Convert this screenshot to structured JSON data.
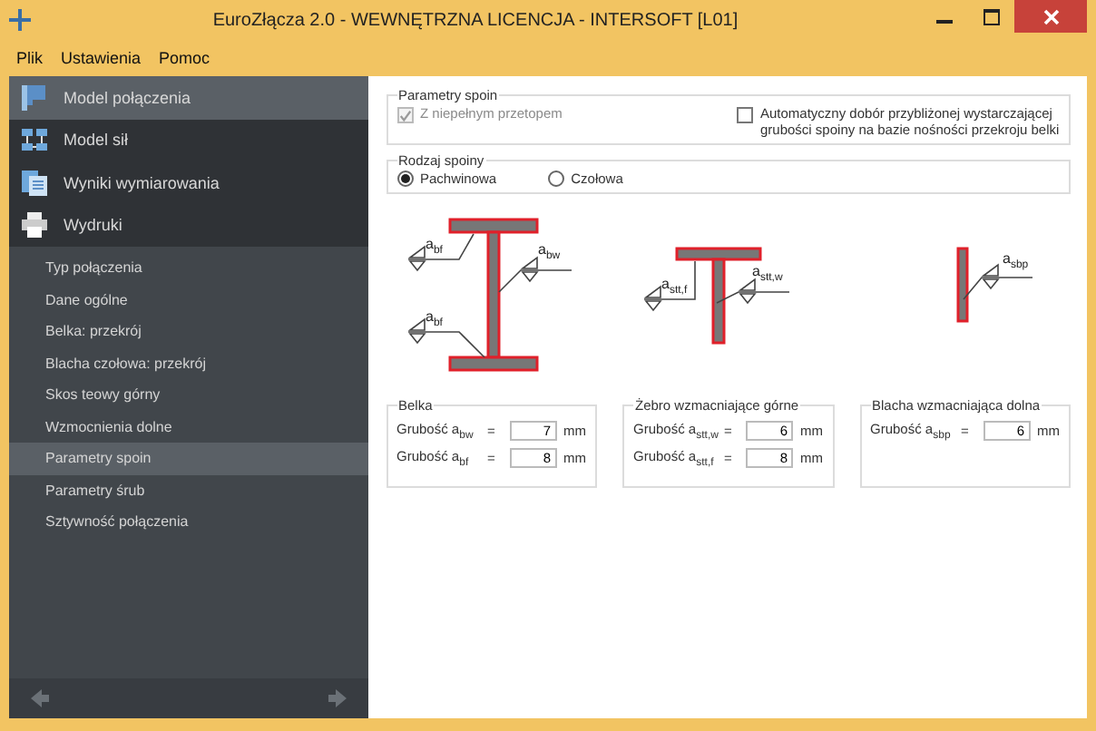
{
  "window": {
    "title": "EuroZłącza 2.0 - WEWNĘTRZNA LICENCJA - INTERSOFT [L01]"
  },
  "menu": [
    "Plik",
    "Ustawienia",
    "Pomoc"
  ],
  "nav": [
    {
      "label": "Model połączenia",
      "kind": "model",
      "selected": true
    },
    {
      "label": "Model sił",
      "kind": "forces",
      "selected": false
    },
    {
      "label": "Wyniki wymiarowania",
      "kind": "results",
      "selected": false
    },
    {
      "label": "Wydruki",
      "kind": "print",
      "selected": false
    }
  ],
  "subnav": [
    {
      "label": "Typ połączenia",
      "selected": false
    },
    {
      "label": "Dane ogólne",
      "selected": false
    },
    {
      "label": "Belka: przekrój",
      "selected": false
    },
    {
      "label": "Blacha czołowa: przekrój",
      "selected": false
    },
    {
      "label": "Skos teowy górny",
      "selected": false
    },
    {
      "label": "Wzmocnienia dolne",
      "selected": false
    },
    {
      "label": "Parametry spoin",
      "selected": true
    },
    {
      "label": "Parametry śrub",
      "selected": false
    },
    {
      "label": "Sztywność połączenia",
      "selected": false
    }
  ],
  "weld_params": {
    "title": "Parametry spoin",
    "options": [
      {
        "label": "Z niepełnym przetopem",
        "checked": true,
        "disabled": true
      },
      {
        "label": "Automatyczny dobór przybliżonej wystarczającej grubości spoiny na bazie nośności przekroju belki",
        "checked": false,
        "disabled": false
      }
    ]
  },
  "weld_type": {
    "title": "Rodzaj spoiny",
    "options": [
      {
        "label": "Pachwinowa",
        "selected": true
      },
      {
        "label": "Czołowa",
        "selected": false
      }
    ]
  },
  "diagrams": [
    {
      "kind": "i-beam",
      "labels": [
        "a$_{bf}$",
        "a$_{bw}$",
        "a$_{bf}$"
      ]
    },
    {
      "kind": "t-rib",
      "labels": [
        "a$_{stt,f}$",
        "a$_{stt,w}$"
      ]
    },
    {
      "kind": "plate",
      "labels": [
        "a$_{sbp}$"
      ]
    }
  ],
  "groups": [
    {
      "title": "Belka",
      "fields": [
        {
          "label": "Grubość a$_{bw}$",
          "sign": "=",
          "value": "7",
          "unit": "mm"
        },
        {
          "label": "Grubość a$_{bf}$",
          "sign": "=",
          "value": "8",
          "unit": "mm"
        }
      ]
    },
    {
      "title": "Żebro wzmacniające górne",
      "fields": [
        {
          "label": "Grubość a$_{stt,w}$",
          "sign": "=",
          "value": "6",
          "unit": "mm"
        },
        {
          "label": "Grubość a$_{stt,f}$",
          "sign": "=",
          "value": "8",
          "unit": "mm"
        }
      ]
    },
    {
      "title": "Blacha wzmacniająca dolna",
      "fields": [
        {
          "label": "Grubość a$_{sbp}$",
          "sign": "=",
          "value": "6",
          "unit": "mm"
        }
      ]
    }
  ]
}
